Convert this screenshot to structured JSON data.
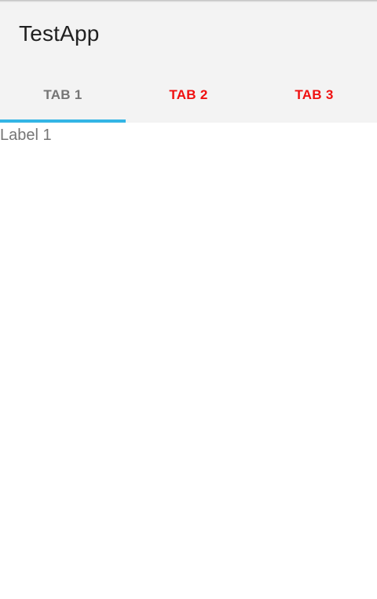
{
  "app_bar": {
    "title": "TestApp"
  },
  "tabs": [
    {
      "label": "TAB 1",
      "selected": true
    },
    {
      "label": "TAB 2",
      "selected": false
    },
    {
      "label": "TAB 3",
      "selected": false
    }
  ],
  "content": {
    "label": "Label 1"
  },
  "colors": {
    "indicator": "#33b5e5",
    "unselected_tab_text": "#f01010",
    "selected_tab_text": "#757575",
    "bar_background": "#f3f3f3"
  }
}
